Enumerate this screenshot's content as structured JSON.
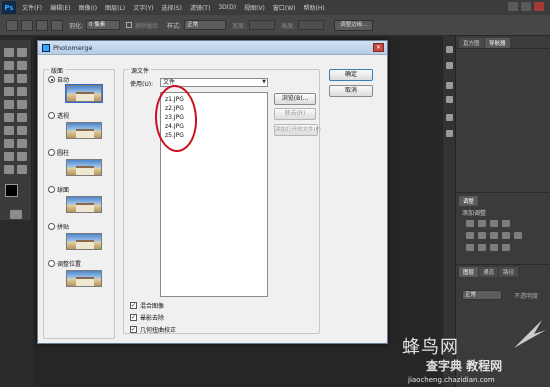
{
  "app": {
    "logo": "Ps",
    "menu": [
      "文件(F)",
      "编辑(E)",
      "图像(I)",
      "图层(L)",
      "文字(Y)",
      "选择(S)",
      "滤镜(T)",
      "3D(D)",
      "视图(V)",
      "窗口(W)",
      "帮助(H)"
    ]
  },
  "options": {
    "feather_label": "羽化:",
    "feather_value": "0 像素",
    "antialias_label": "消除锯齿",
    "style_label": "样式:",
    "style_value": "正常",
    "width_label": "宽度:",
    "height_label": "高度:",
    "refine_edge": "调整边缘..."
  },
  "panels": {
    "tab_history": "直方图",
    "tab_navigator": "导航器",
    "adjust_tab": "调整",
    "adjust_title": "添加调整",
    "layers_tab": "图层",
    "channels_tab": "通道",
    "paths_tab": "路径",
    "blend_mode": "正常",
    "opacity": "不透明度"
  },
  "dialog": {
    "title": "Photomerge",
    "layout_label": "版面",
    "layouts": [
      "自动",
      "透视",
      "圆柱",
      "球面",
      "拼贴",
      "调整位置"
    ],
    "selected_layout": "自动",
    "source_label": "源文件",
    "use_label": "使用(U):",
    "use_value": "文件",
    "files": [
      "z1.JPG",
      "z2.JPG",
      "z3.JPG",
      "z4.JPG",
      "z5.JPG"
    ],
    "browse_button": "浏览(B)...",
    "remove_button": "移去(R)",
    "add_open_button": "添加打开的文件(F)",
    "ok_button": "确定",
    "cancel_button": "取消",
    "options": [
      {
        "label": "混合图像",
        "checked": true
      },
      {
        "label": "晕影去除",
        "checked": true
      },
      {
        "label": "几何扭曲校正",
        "checked": true
      }
    ]
  },
  "watermark": {
    "line1": "蜂鸟网",
    "line2": "查字典 教程网",
    "line3": "jiaocheng.chazidian.com"
  },
  "colors": {
    "annotation": "#cc1020",
    "ps_blue": "#35a3ff"
  }
}
